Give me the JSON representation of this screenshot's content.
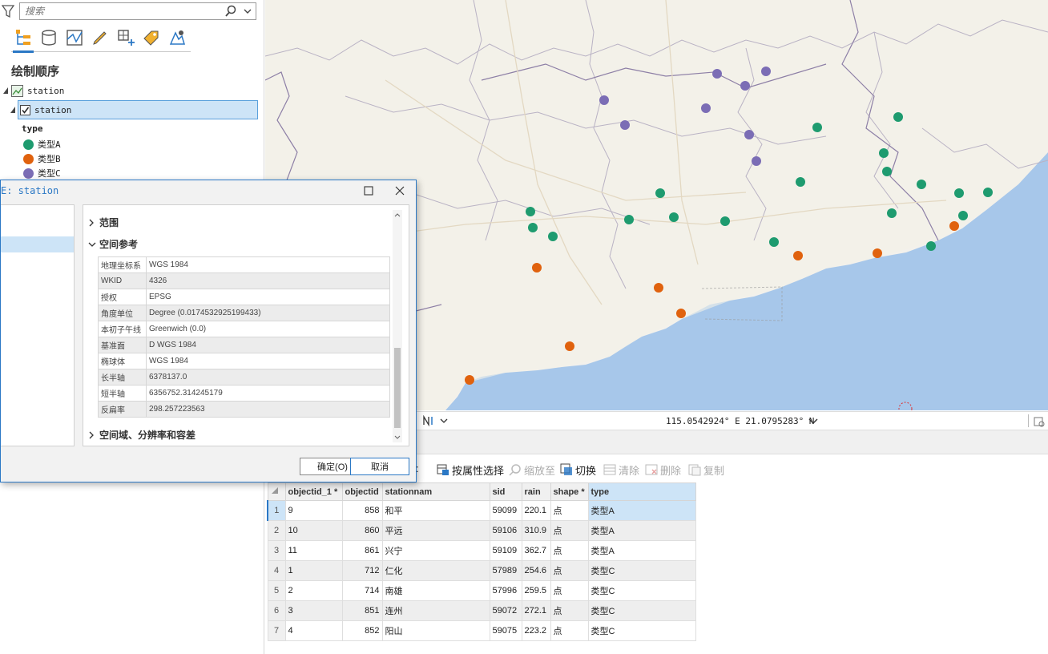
{
  "search": {
    "placeholder": "搜索"
  },
  "contents": {
    "heading": "绘制顺序",
    "map_name": "station",
    "layer_name": "station",
    "legend_field": "type",
    "legend": [
      {
        "label": "类型A",
        "color": "#1e9b6f"
      },
      {
        "label": "类型B",
        "color": "#e0620e"
      },
      {
        "label": "类型C",
        "color": "#7b6db5"
      }
    ]
  },
  "statusbar": {
    "coords": "115.0542924° E 21.0795283° N"
  },
  "table_toolbar": {
    "select_by_attr": "按属性选择",
    "zoom_to": "缩放至",
    "switch": "切换",
    "clear": "清除",
    "delete": "删除",
    "copy": "复制"
  },
  "table": {
    "columns": [
      "objectid_1 *",
      "objectid",
      "stationnam",
      "sid",
      "rain",
      "shape *",
      "type"
    ],
    "rows": [
      {
        "n": "1",
        "objectid_1": "9",
        "objectid": "858",
        "stationnam": "和平",
        "sid": "59099",
        "rain": "220.1",
        "shape": "点",
        "type": "类型A"
      },
      {
        "n": "2",
        "objectid_1": "10",
        "objectid": "860",
        "stationnam": "平远",
        "sid": "59106",
        "rain": "310.9",
        "shape": "点",
        "type": "类型A"
      },
      {
        "n": "3",
        "objectid_1": "11",
        "objectid": "861",
        "stationnam": "兴宁",
        "sid": "59109",
        "rain": "362.7",
        "shape": "点",
        "type": "类型A"
      },
      {
        "n": "4",
        "objectid_1": "1",
        "objectid": "712",
        "stationnam": "仁化",
        "sid": "57989",
        "rain": "254.6",
        "shape": "点",
        "type": "类型C"
      },
      {
        "n": "5",
        "objectid_1": "2",
        "objectid": "714",
        "stationnam": "南雄",
        "sid": "57996",
        "rain": "259.5",
        "shape": "点",
        "type": "类型C"
      },
      {
        "n": "6",
        "objectid_1": "3",
        "objectid": "851",
        "stationnam": "连州",
        "sid": "59072",
        "rain": "272.1",
        "shape": "点",
        "type": "类型C"
      },
      {
        "n": "7",
        "objectid_1": "4",
        "objectid": "852",
        "stationnam": "阳山",
        "sid": "59075",
        "rain": "223.2",
        "shape": "点",
        "type": "类型C"
      }
    ]
  },
  "dialog": {
    "title": "E: station",
    "section_extent": "范围",
    "section_sr": "空间参考",
    "section_domain": "空间域、分辨率和容差",
    "properties": [
      {
        "k": "地理坐标系",
        "v": "WGS 1984"
      },
      {
        "k": "WKID",
        "v": "4326"
      },
      {
        "k": "授权",
        "v": "EPSG"
      },
      {
        "k": "角度单位",
        "v": "Degree (0.0174532925199433)"
      },
      {
        "k": "本初子午线",
        "v": "Greenwich (0.0)"
      },
      {
        "k": "基准面",
        "v": "D WGS 1984"
      },
      {
        "k": "椭球体",
        "v": "WGS 1984"
      },
      {
        "k": "长半轴",
        "v": "6378137.0"
      },
      {
        "k": "短半轴",
        "v": "6356752.314245179"
      },
      {
        "k": "反扁率",
        "v": "298.257223563"
      }
    ],
    "ok": "确定(O)",
    "cancel": "取消"
  }
}
